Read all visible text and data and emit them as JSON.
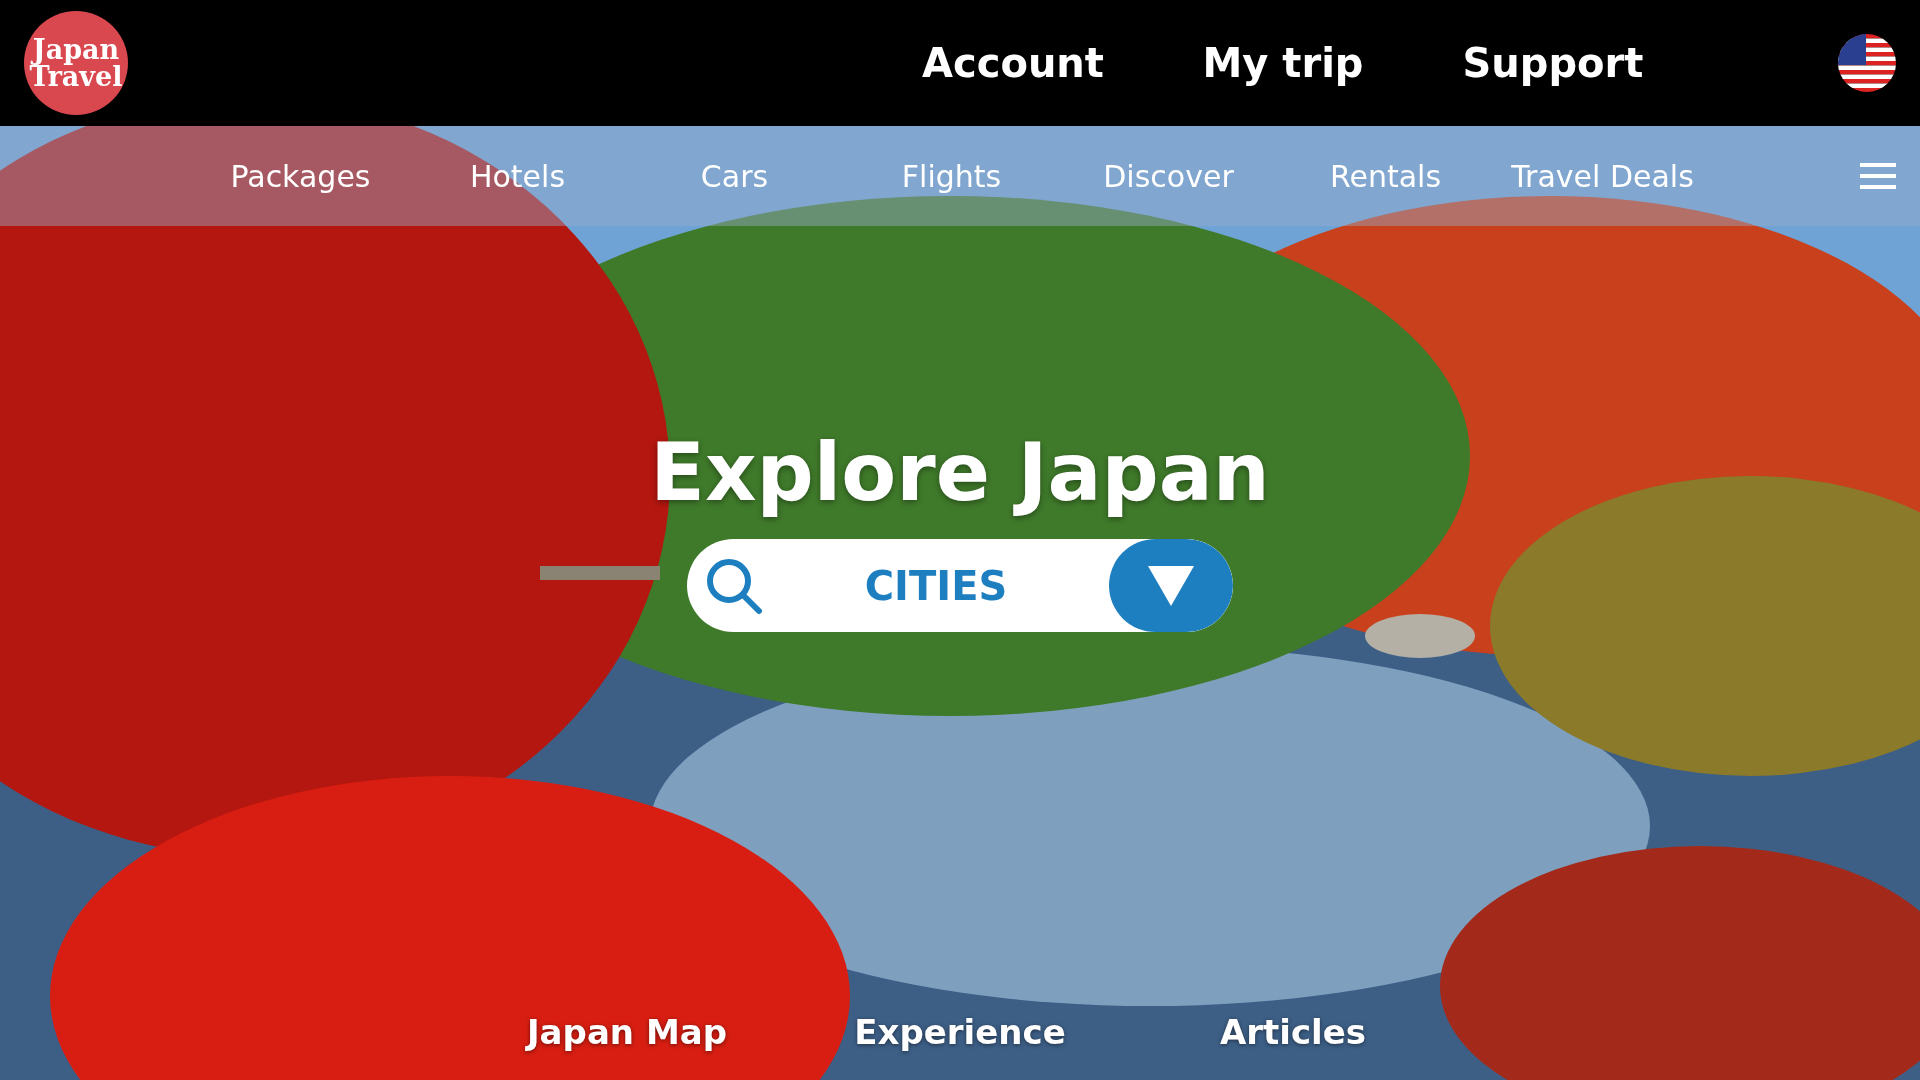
{
  "logo": {
    "text": "Japan Travel"
  },
  "top_links": [
    {
      "label": "Account"
    },
    {
      "label": "My trip"
    },
    {
      "label": "Support"
    }
  ],
  "nav": [
    {
      "label": "Packages"
    },
    {
      "label": "Hotels"
    },
    {
      "label": "Cars"
    },
    {
      "label": "Flights"
    },
    {
      "label": "Discover"
    },
    {
      "label": "Rentals"
    },
    {
      "label": "Travel Deals"
    }
  ],
  "hero": {
    "title": "Explore Japan"
  },
  "search": {
    "value": "CITIES"
  },
  "bottom_links": [
    {
      "label": "Japan Map"
    },
    {
      "label": "Experience"
    },
    {
      "label": "Articles"
    }
  ]
}
